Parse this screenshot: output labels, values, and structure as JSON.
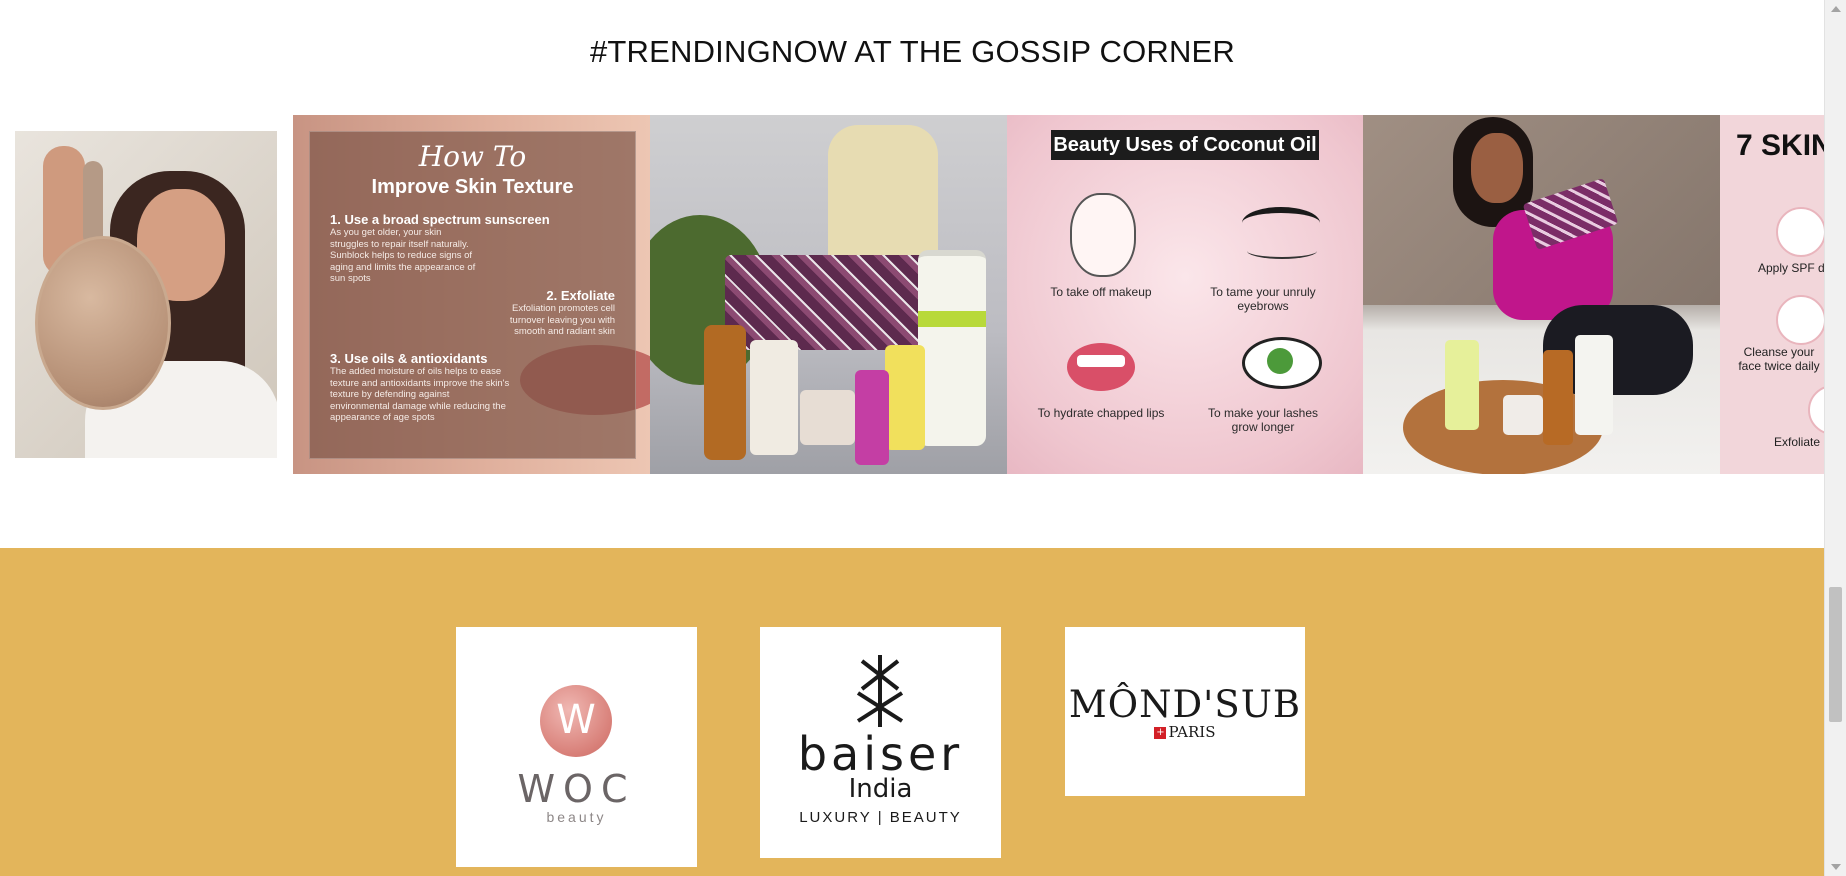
{
  "page": {
    "section_title": "#TRENDINGNOW AT THE GOSSIP CORNER"
  },
  "gallery": {
    "skin_texture": {
      "script_title": "How To",
      "title": "Improve Skin Texture",
      "step1_title": "1. Use a broad spectrum sunscreen",
      "step1_text": "As you get older, your skin struggles to repair itself naturally. Sunblock helps to reduce signs of aging and limits the appearance of sun spots",
      "step2_title": "2. Exfoliate",
      "step2_text": "Exfoliation promotes cell turnover leaving you with smooth and radiant skin",
      "step3_title": "3. Use oils & antioxidants",
      "step3_text": "The added moisture of oils helps to ease texture and antioxidants improve the skin's texture by defending against environmental damage while reducing the appearance of age spots"
    },
    "coconut": {
      "title": "Beauty Uses of Coconut Oil",
      "use1": "To take off makeup",
      "use2": "To tame your unruly eyebrows",
      "use3": "To hydrate chapped lips",
      "use4": "To make your lashes grow longer"
    },
    "seven_skin": {
      "title": "7 SKIN",
      "item1": "Apply SPF d",
      "item2": "Cleanse your face twice daily",
      "item3": "Exfoliate"
    }
  },
  "brands": {
    "woc": {
      "name": "WOC",
      "sub": "beauty",
      "mark": "W",
      "mark_color": "#d87f78"
    },
    "baiser": {
      "name": "baiser",
      "line2": "India",
      "sub": "LUXURY | BEAUTY"
    },
    "mondsub": {
      "name": "MÔND'SUB",
      "sub": "PARIS"
    }
  },
  "colors": {
    "brand_band": "#e3b55b",
    "title_text": "#111111"
  }
}
